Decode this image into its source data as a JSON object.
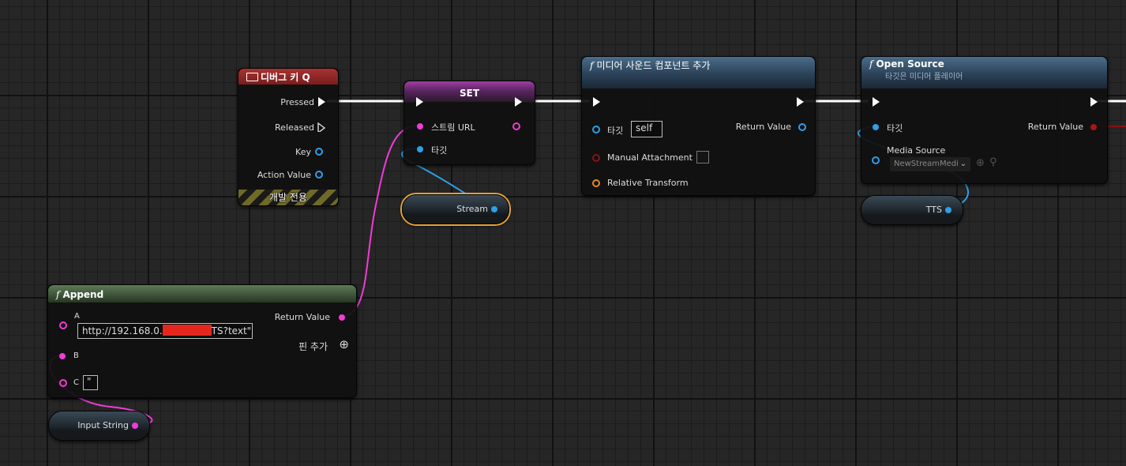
{
  "debug_key_node": {
    "title": "디버그 키 Q",
    "pins": {
      "pressed": "Pressed",
      "released": "Released",
      "key": "Key",
      "action_value": "Action Value"
    },
    "footer": "개발 전용"
  },
  "set_node": {
    "title": "SET",
    "pins": {
      "stream_url": "스트림 URL",
      "target": "타깃"
    }
  },
  "stream_var": {
    "label": "Stream"
  },
  "add_media_node": {
    "title": "미디어 사운드 컴포넌트 추가",
    "pins": {
      "target": "타깃",
      "target_value": "self",
      "manual_attachment": "Manual Attachment",
      "relative_transform": "Relative Transform",
      "return_value": "Return Value"
    }
  },
  "open_source_node": {
    "title": "Open Source",
    "subtitle": "타깃은 미디어 플레이어",
    "pins": {
      "target": "타깃",
      "media_source": "Media Source",
      "media_source_value": "NewStreamMedi",
      "return_value": "Return Value"
    }
  },
  "tts_var": {
    "label": "TTS"
  },
  "append_node": {
    "title": "Append",
    "pins": {
      "a": "A",
      "a_value_prefix": "http://192.168.0.",
      "a_value_suffix": "TS?text\"",
      "b": "B",
      "c": "C",
      "c_value": "\"",
      "return_value": "Return Value",
      "add_pin": "핀 추가"
    }
  },
  "input_string_var": {
    "label": "Input String"
  },
  "colors": {
    "exec": "#ffffff",
    "string": "#f13cd5",
    "object": "#2f9fe8",
    "struct": "#e6881e",
    "bool": "#8a1212",
    "selection": "#e3a23a"
  }
}
